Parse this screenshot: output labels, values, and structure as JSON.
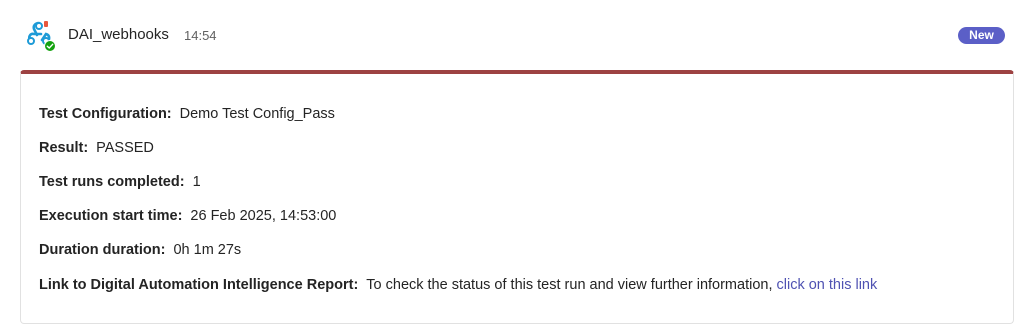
{
  "message": {
    "sender": "DAI_webhooks",
    "time": "14:54",
    "badge": "New",
    "accent_color": "#9d4242",
    "badge_color": "#5b5fc7",
    "avatar_icon": "webhook-icon",
    "status_icon": "check-icon"
  },
  "card": {
    "rows": [
      {
        "label": "Test Configuration:",
        "value": "Demo Test Config_Pass"
      },
      {
        "label": "Result:",
        "value": "PASSED"
      },
      {
        "label": "Test runs completed:",
        "value": "1"
      },
      {
        "label": "Execution start time:",
        "value": "26 Feb 2025, 14:53:00"
      },
      {
        "label": "Duration duration:",
        "value": "0h 1m 27s"
      }
    ],
    "link_row": {
      "label": "Link to Digital Automation Intelligence Report:",
      "text": "To check the status of this test run and view further information,",
      "link_text": "click on this link"
    }
  }
}
